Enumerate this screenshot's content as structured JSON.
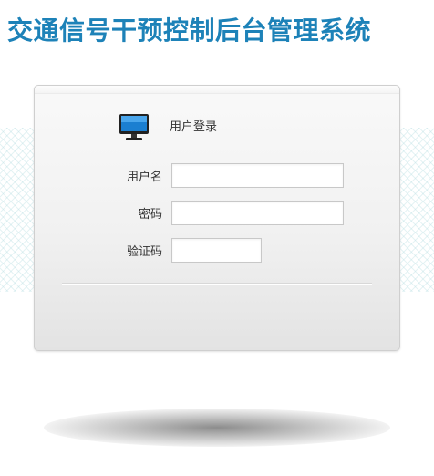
{
  "header": {
    "title": "交通信号干预控制后台管理系统"
  },
  "login": {
    "title": "用户登录",
    "username_label": "用户名",
    "username_value": "",
    "password_label": "密码",
    "password_value": "",
    "captcha_label": "验证码",
    "captcha_value": ""
  },
  "icons": {
    "monitor": "monitor-icon"
  },
  "colors": {
    "title": "#1d82b8",
    "panel_border": "#cfcfcf",
    "monitor_screen": "#1b7fd1",
    "monitor_body": "#222222"
  }
}
